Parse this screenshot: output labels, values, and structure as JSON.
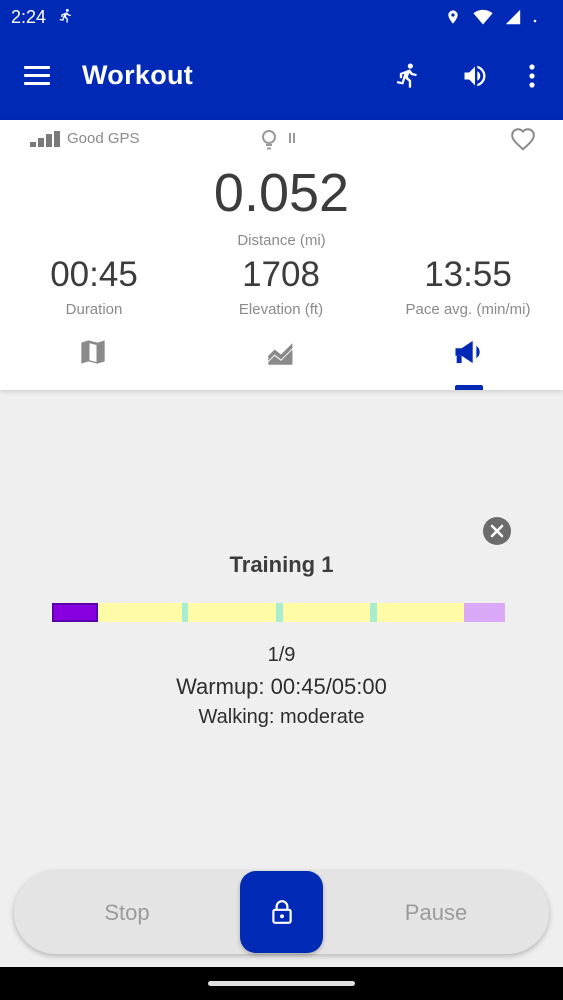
{
  "status_bar": {
    "time": "2:24",
    "icons": [
      "running-icon",
      "location-icon",
      "wifi-icon",
      "signal-icon",
      "dot-icon"
    ]
  },
  "app_bar": {
    "title": "Workout",
    "actions": [
      "running-icon",
      "volume-icon",
      "more-vert-icon"
    ],
    "color": "#0029b6"
  },
  "stats": {
    "gps_label": "Good GPS",
    "distance": {
      "value": "0.052",
      "label": "Distance (mi)"
    },
    "duration": {
      "value": "00:45",
      "label": "Duration"
    },
    "elevation": {
      "value": "1708",
      "label": "Elevation (ft)"
    },
    "pace": {
      "value": "13:55",
      "label": "Pace avg. (min/mi)"
    }
  },
  "tabs": [
    {
      "icon": "map-icon",
      "selected": false
    },
    {
      "icon": "area-chart-icon",
      "selected": false
    },
    {
      "icon": "megaphone-icon",
      "selected": true
    }
  ],
  "training": {
    "title": "Training 1",
    "step": "1/9",
    "current": "Warmup: 00:45/05:00",
    "activity": "Walking: moderate",
    "segment_colors": {
      "warmup": "#8800e0",
      "walk": "#fffba6",
      "run": "#a8edd2",
      "cooldown": "#d9a8f7"
    }
  },
  "controls": {
    "stop_label": "Stop",
    "pause_label": "Pause",
    "lock_icon": "lock-icon"
  }
}
